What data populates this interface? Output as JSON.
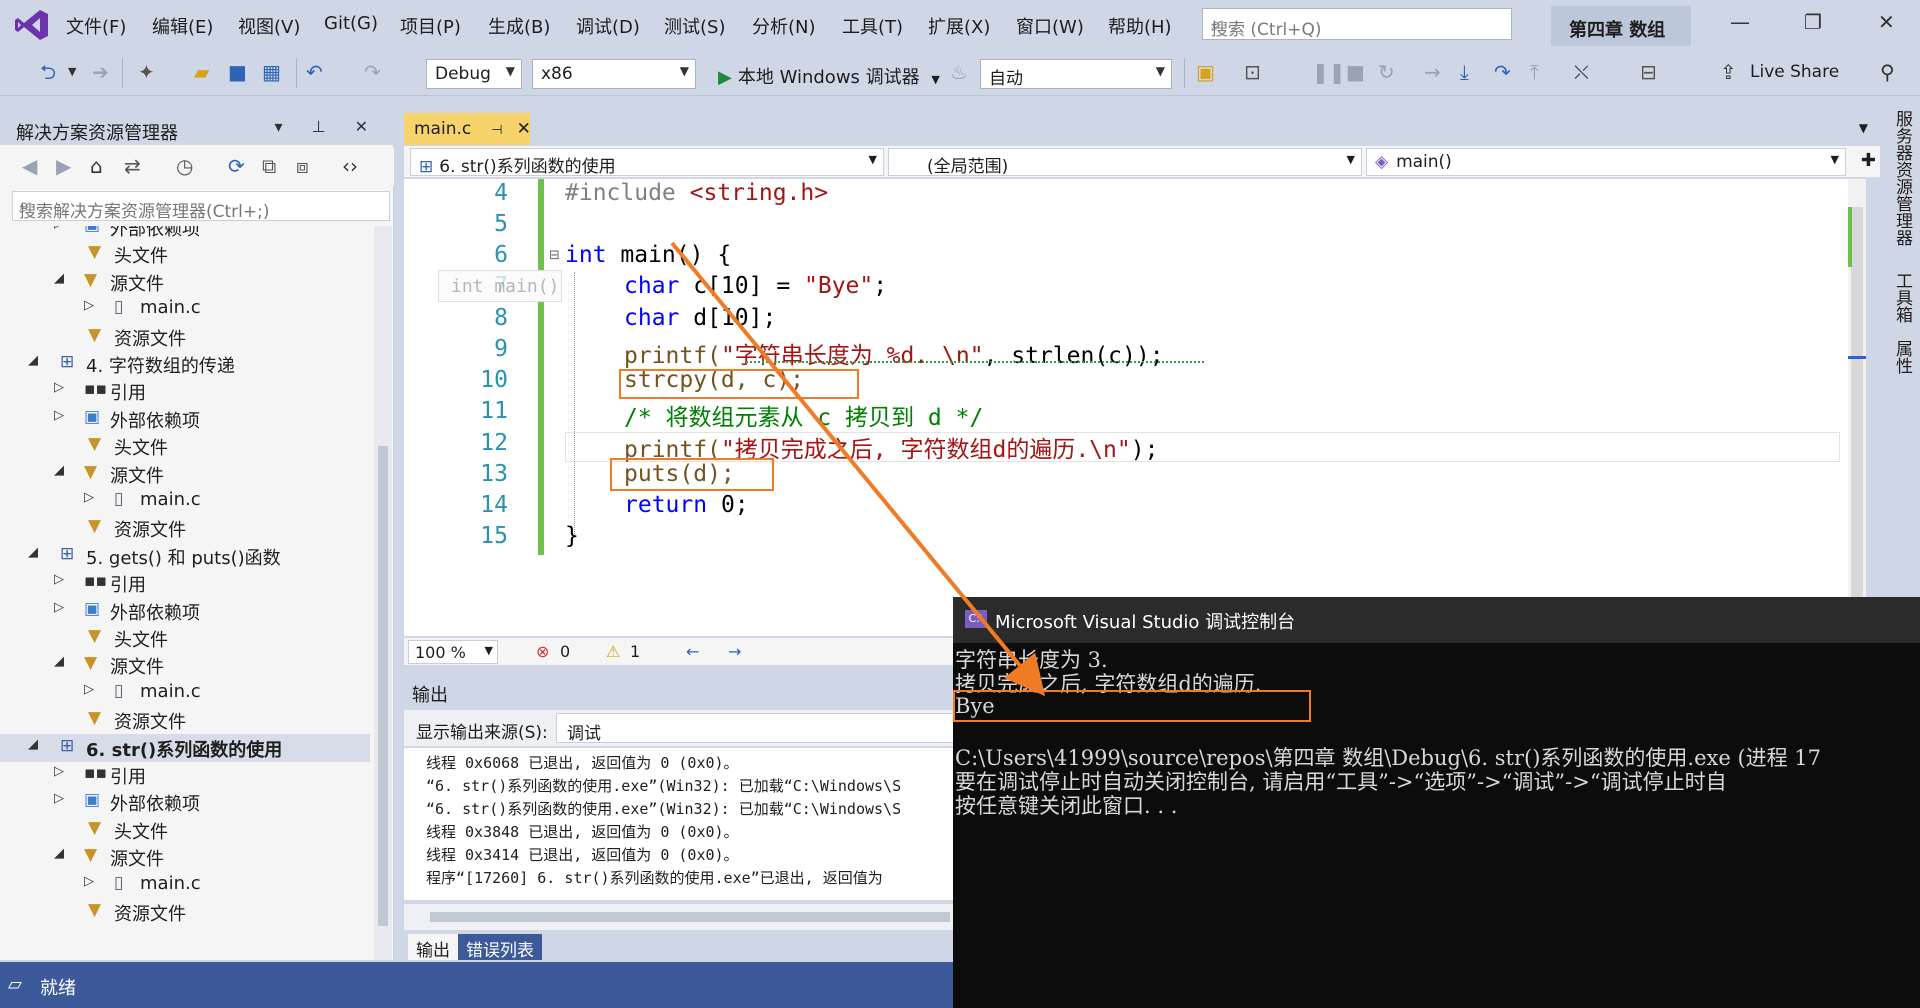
{
  "menubar": {
    "items": [
      "文件(F)",
      "编辑(E)",
      "视图(V)",
      "Git(G)",
      "项目(P)",
      "生成(B)",
      "调试(D)",
      "测试(S)",
      "分析(N)",
      "工具(T)",
      "扩展(X)",
      "窗口(W)",
      "帮助(H)"
    ],
    "search_placeholder": "搜索 (Ctrl+Q)",
    "solution_title": "第四章 数组"
  },
  "toolbar": {
    "config": "Debug",
    "platform": "x86",
    "run_label": "本地 Windows 调试器",
    "auto": "自动",
    "live_share": "Live Share"
  },
  "solution_explorer": {
    "title": "解决方案资源管理器",
    "search_placeholder": "搜索解决方案资源管理器(Ctrl+;)",
    "rows": [
      {
        "label": "外部依赖项",
        "icon": "external-deps-icon"
      },
      {
        "label": "头文件",
        "icon": "folder-filter-icon"
      },
      {
        "label": "源文件",
        "icon": "folder-filter-icon"
      },
      {
        "label": "main.c",
        "icon": "c-file-icon"
      },
      {
        "label": "资源文件",
        "icon": "folder-filter-icon"
      },
      {
        "label": "4. 字符数组的传递",
        "icon": "project-icon"
      },
      {
        "label": "引用",
        "icon": "references-icon"
      },
      {
        "label": "外部依赖项",
        "icon": "external-deps-icon"
      },
      {
        "label": "头文件",
        "icon": "folder-filter-icon"
      },
      {
        "label": "源文件",
        "icon": "folder-filter-icon"
      },
      {
        "label": "main.c",
        "icon": "c-file-icon"
      },
      {
        "label": "资源文件",
        "icon": "folder-filter-icon"
      },
      {
        "label": "5. gets() 和 puts()函数",
        "icon": "project-icon"
      },
      {
        "label": "引用",
        "icon": "references-icon"
      },
      {
        "label": "外部依赖项",
        "icon": "external-deps-icon"
      },
      {
        "label": "头文件",
        "icon": "folder-filter-icon"
      },
      {
        "label": "源文件",
        "icon": "folder-filter-icon"
      },
      {
        "label": "main.c",
        "icon": "c-file-icon"
      },
      {
        "label": "资源文件",
        "icon": "folder-filter-icon"
      },
      {
        "label": "6. str()系列函数的使用",
        "icon": "project-icon"
      },
      {
        "label": "引用",
        "icon": "references-icon"
      },
      {
        "label": "外部依赖项",
        "icon": "external-deps-icon"
      },
      {
        "label": "头文件",
        "icon": "folder-filter-icon"
      },
      {
        "label": "源文件",
        "icon": "folder-filter-icon"
      },
      {
        "label": "main.c",
        "icon": "c-file-icon"
      },
      {
        "label": "资源文件",
        "icon": "folder-filter-icon"
      }
    ]
  },
  "editor": {
    "tab": "main.c",
    "nav_scope": "6. str()系列函数的使用",
    "nav_global": "(全局范围)",
    "nav_func": "main()",
    "hint": "int main()",
    "line_numbers": [
      "4",
      "5",
      "6",
      "7",
      "8",
      "9",
      "10",
      "11",
      "12",
      "13",
      "14",
      "15"
    ],
    "zoom": "100 %",
    "errors": "0",
    "warnings": "1"
  },
  "code": {
    "l4_a": "#include ",
    "l4_b": "<string.h>",
    "l6_kw": "int",
    "l6_rest": " main() {",
    "l7_kw": "char",
    "l7_a": " c[10] = ",
    "l7_str": "\"Bye\"",
    "l7_end": ";",
    "l8_kw": "char",
    "l8_a": " d[10];",
    "l9_a": "printf(",
    "l9_str": "\"字符串长度为 %d. \\n\"",
    "l9_b": ", strlen(c));",
    "l10": "strcpy(d, c);",
    "l11": "/* 将数组元素从 c 拷贝到 d */",
    "l12_a": "printf(",
    "l12_str": "\"拷贝完成之后, 字符数组d的遍历.\\n\"",
    "l12_b": ");",
    "l13": "puts(d);",
    "l14_kw": "return",
    "l14_a": " 0;",
    "l15": "}"
  },
  "output": {
    "title": "输出",
    "source_label": "显示输出来源(S):",
    "source_value": "调试",
    "lines": [
      "线程 0x6068 已退出, 返回值为 0 (0x0)。",
      "“6. str()系列函数的使用.exe”(Win32): 已加载“C:\\Windows\\S",
      "“6. str()系列函数的使用.exe”(Win32): 已加载“C:\\Windows\\S",
      "线程 0x3848 已退出, 返回值为 0 (0x0)。",
      "线程 0x3414 已退出, 返回值为 0 (0x0)。",
      "程序“[17260] 6. str()系列函数的使用.exe”已退出, 返回值为"
    ],
    "tab_output": "输出",
    "tab_errors": "错误列表"
  },
  "console": {
    "title": "Microsoft Visual Studio 调试控制台",
    "lines": [
      "字符串长度为 3.",
      "拷贝完成之后, 字符数组d的遍历.",
      "Bye",
      "",
      "C:\\Users\\41999\\source\\repos\\第四章 数组\\Debug\\6. str()系列函数的使用.exe (进程 17",
      "要在调试停止时自动关闭控制台, 请启用“工具”->“选项”->“调试”->“调试停止时自",
      "按任意键关闭此窗口. . ."
    ]
  },
  "right_strip": [
    "服务器资源管理器",
    "工具箱",
    "属性"
  ],
  "statusbar": {
    "text": "就绪"
  },
  "colors": {
    "accent": "#3c5a9a",
    "annotation": "#f07b24",
    "active_tab": "#f6d36b"
  }
}
